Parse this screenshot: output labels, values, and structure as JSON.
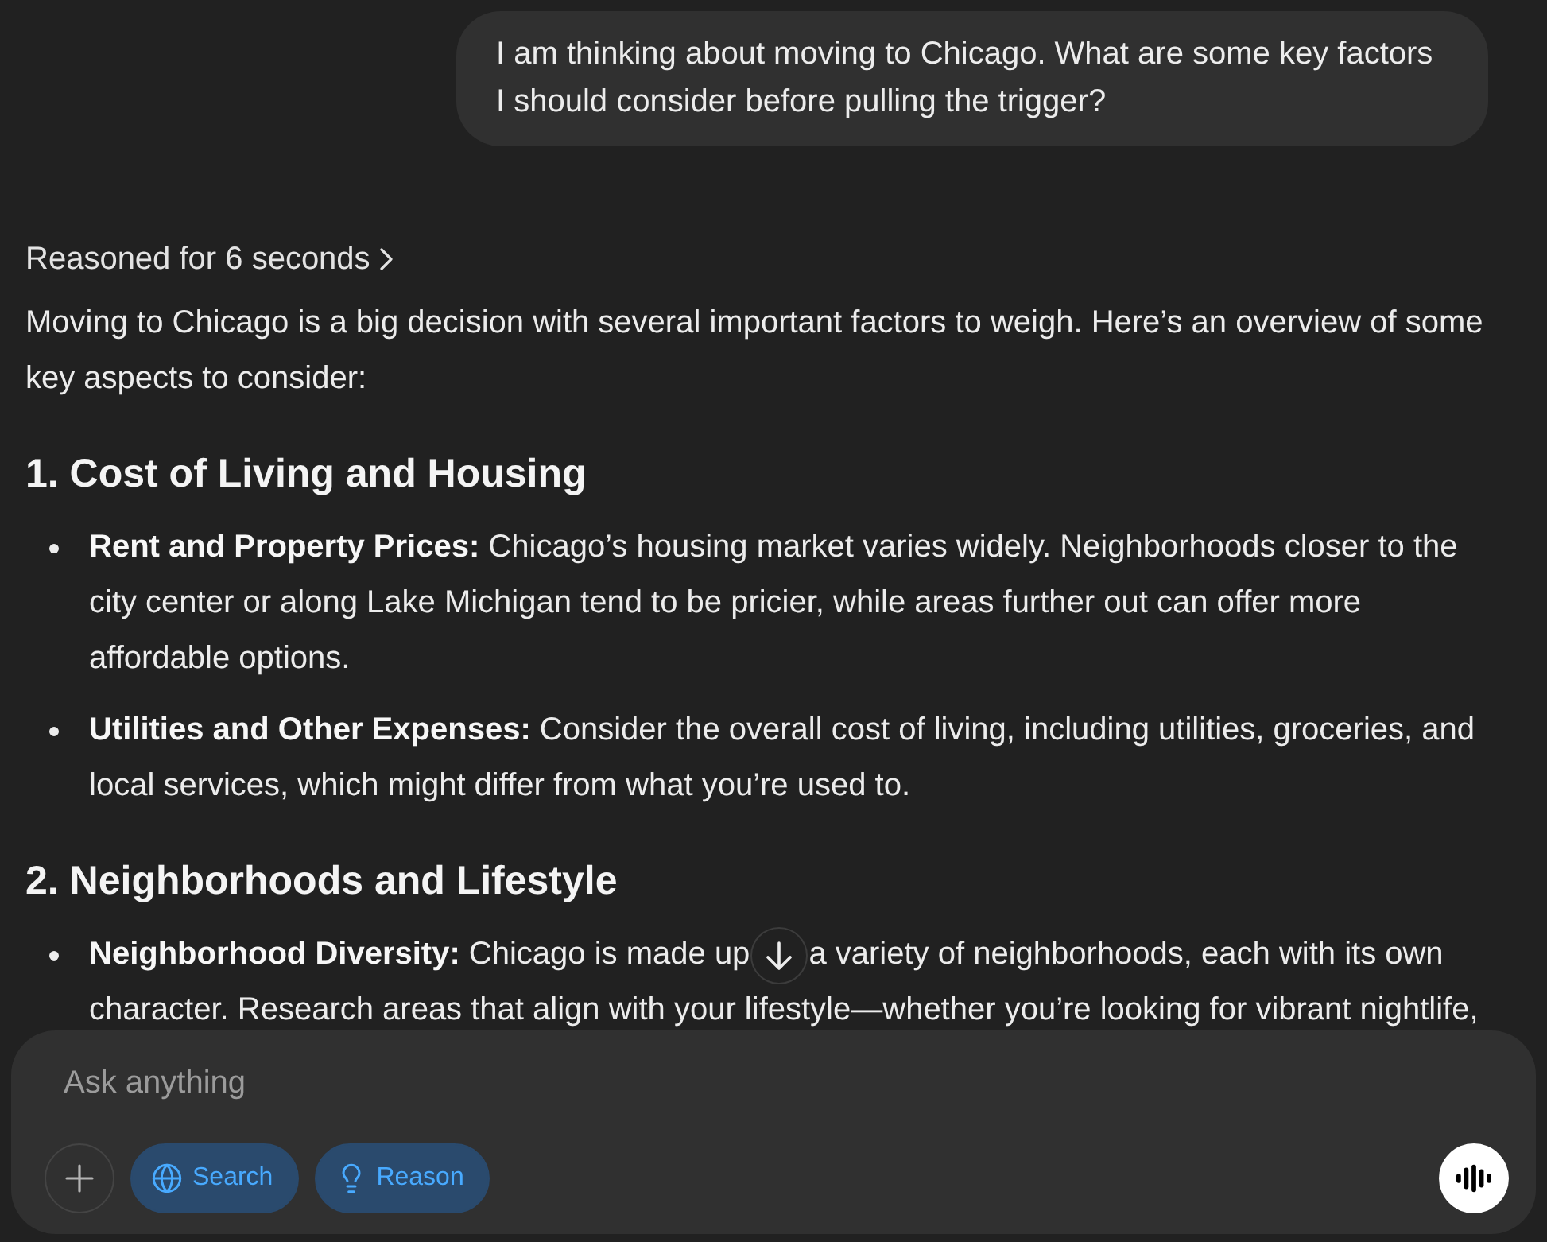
{
  "user_message": {
    "text": "I am thinking about moving to Chicago. What are some key factors I should consider before pulling the trigger?"
  },
  "assistant_message": {
    "reasoning": {
      "label": "Reasoned for 6 seconds"
    },
    "blocks": [
      {
        "kind": "paragraph",
        "text": "Moving to Chicago is a big decision with several important factors to weigh. Here’s an overview of some key aspects to consider:"
      },
      {
        "kind": "heading",
        "text": "1. Cost of Living and Housing"
      },
      {
        "kind": "bullets",
        "items": [
          {
            "kind": "text",
            "text": "**Rent and Property Prices:** Chicago’s housing market varies widely. Neighborhoods closer to the city center or along Lake Michigan tend to be pricier, while areas further out can offer more affordable options."
          },
          {
            "kind": "text",
            "text": "**Utilities and Other Expenses:** Consider the overall cost of living, including utilities, groceries, and local services, which might differ from what you’re used to."
          }
        ]
      },
      {
        "kind": "heading",
        "text": "2. Neighborhoods and Lifestyle"
      },
      {
        "kind": "bullets",
        "items": [
          {
            "kind": "split",
            "parts": [
              "**Neighborhood Diversity:** Chicago is made up",
              "a variety of neighborhoods, each with its own",
              "character. Research areas that align with your lifestyle—whether you’re looking for vibrant nightlife,"
            ]
          }
        ]
      }
    ]
  },
  "composer": {
    "placeholder": "Ask anything",
    "tools": [
      {
        "kind": "search",
        "label": "Search",
        "selected": true
      },
      {
        "kind": "reason",
        "label": "Reason",
        "selected": true
      }
    ]
  }
}
